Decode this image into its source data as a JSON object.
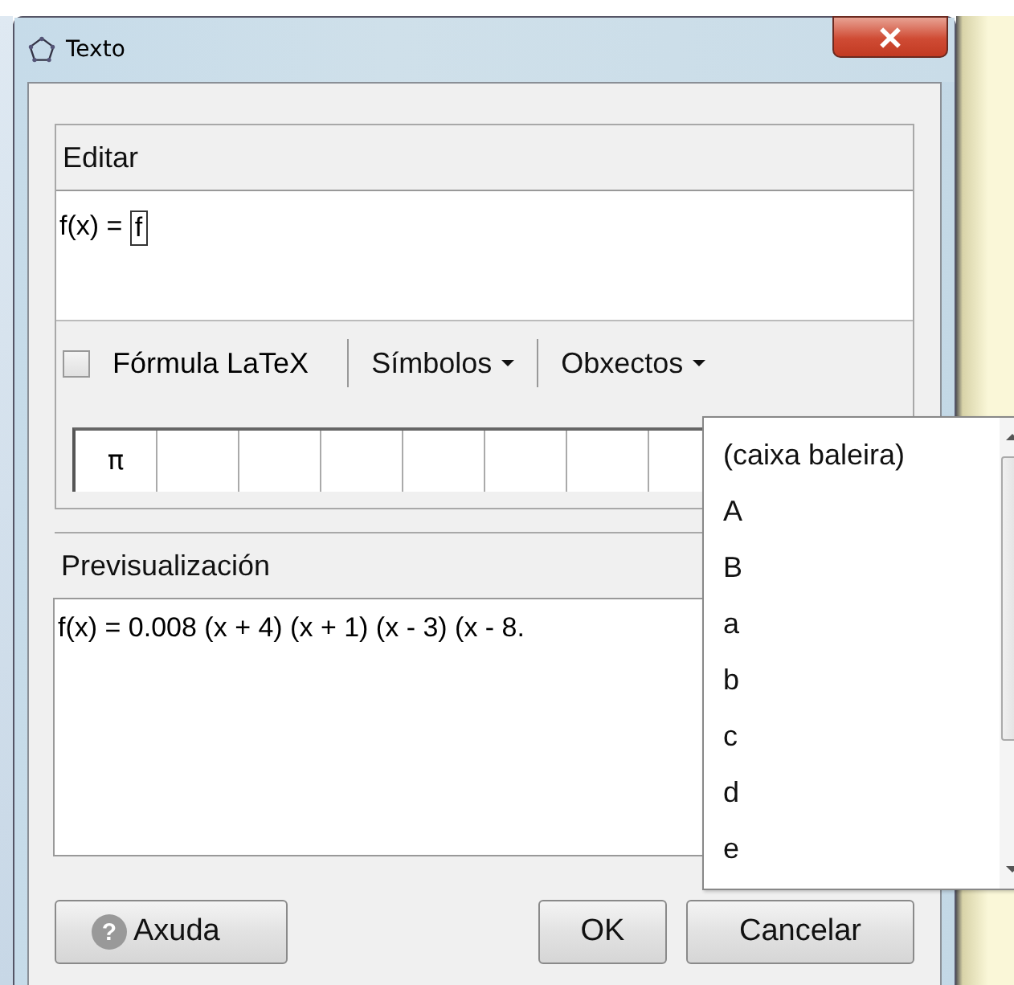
{
  "window": {
    "title": "Texto"
  },
  "edit": {
    "label": "Editar",
    "text": "f(x) = ",
    "cursor_text": "f"
  },
  "toolbar": {
    "latex": {
      "label": "Fórmula LaTeX",
      "checked": false
    },
    "menus": [
      {
        "label": "Símbolos"
      },
      {
        "label": "Obxectos"
      }
    ]
  },
  "symbols": [
    "π"
  ],
  "preview": {
    "label": "Previsualización",
    "text": "f(x) = 0.008 (x + 4) (x + 1) (x - 3) (x - 8."
  },
  "dropdown": {
    "items": [
      {
        "label": "(caixa baleira)"
      },
      {
        "label": "A"
      },
      {
        "label": "B"
      },
      {
        "label": "a"
      },
      {
        "label": "b"
      },
      {
        "label": "c"
      },
      {
        "label": "d"
      },
      {
        "label": "e"
      }
    ]
  },
  "buttons": {
    "help": {
      "icon": "?",
      "label": "Axuda"
    },
    "ok": "OK",
    "cancel": "Cancelar"
  }
}
